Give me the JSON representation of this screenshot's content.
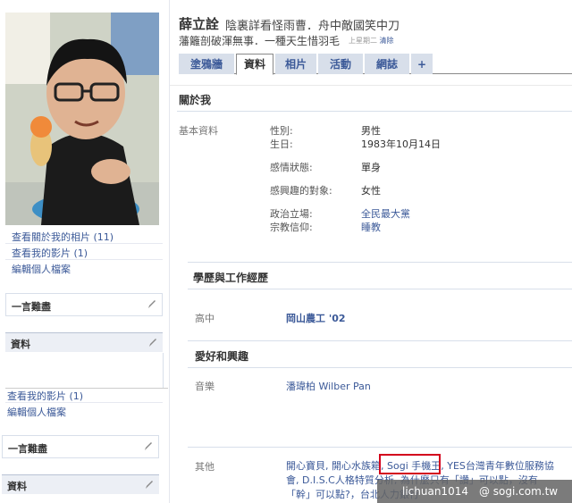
{
  "profile": {
    "name": "薛立詮",
    "status_line1": "陰裏詳看怪雨曹．舟中敵國笑中刀",
    "status_line2": "藩籬剖破渾無事．一種天生惜羽毛",
    "status_time": "上星期二",
    "status_action": "清除"
  },
  "tabs": [
    "塗鴉牆",
    "資料",
    "相片",
    "活動",
    "網誌",
    "+"
  ],
  "left": {
    "links": [
      "查看關於我的相片 (11)",
      "查看我的影片 (1)",
      "編輯個人檔案"
    ],
    "box1_title": "一言難盡",
    "box2_title": "資料",
    "dup_links": [
      "查看我的影片 (1)",
      "編輯個人檔案"
    ],
    "box3_title": "一言難盡",
    "box4_title": "資料"
  },
  "about": {
    "heading": "關於我",
    "section_label": "基本資料",
    "rows": [
      {
        "key": "性別:",
        "value": "男性"
      },
      {
        "key": "生日:",
        "value": "1983年10月14日"
      },
      {
        "key": "感情狀態:",
        "value": "單身"
      },
      {
        "key": "感興趣的對象:",
        "value": "女性"
      },
      {
        "key": "政治立場:",
        "value": "全民最大黨"
      },
      {
        "key": "宗教信仰:",
        "value": "睡教"
      }
    ]
  },
  "education": {
    "heading": "學歷與工作經歷",
    "label": "高中",
    "value": "岡山農工 '02"
  },
  "interests": {
    "heading": "愛好和興趣",
    "music_label": "音樂",
    "music_value": "潘瑋柏 Wilber Pan",
    "other_label": "其他",
    "other_part1": "開心寶貝, 開心水族箱, ",
    "other_highlight": "Sogi 手機王",
    "other_part2": ", YES台灣青年數位服務協會, D.I.S.C人格特質分析, 為什麼只有「讚」可以點，沒有「幹」可以點?，台北人力銀行"
  },
  "watermark": "lichuan1014　@ sogi.com.tw",
  "colors": {
    "link": "#3b5998",
    "tab_bg": "#d8dfea",
    "highlight": "#d3001c"
  }
}
